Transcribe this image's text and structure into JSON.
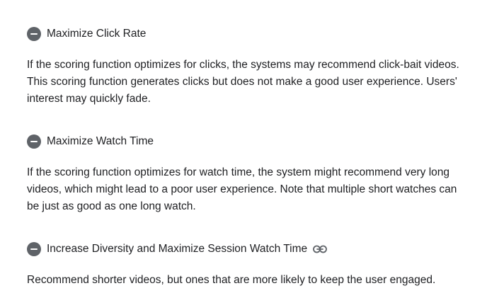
{
  "sections": [
    {
      "heading": "Maximize Click Rate",
      "icon": "minus-circle-icon",
      "body": "If the scoring function optimizes for clicks, the systems may recommend click-bait videos. This scoring function generates clicks but does not make a good user experience. Users' interest may quickly fade."
    },
    {
      "heading": "Maximize Watch Time",
      "icon": "minus-circle-icon",
      "body": "If the scoring function optimizes for watch time, the system might recommend very long videos, which might lead to a poor user experience. Note that multiple short watches can be just as good as one long watch."
    },
    {
      "heading": "Increase Diversity and Maximize Session Watch Time",
      "icon": "minus-circle-icon",
      "link_icon": "link-icon",
      "body": "Recommend shorter videos, but ones that are more likely to keep the user engaged."
    }
  ],
  "colors": {
    "text": "#202124",
    "icon": "#5f6368"
  }
}
